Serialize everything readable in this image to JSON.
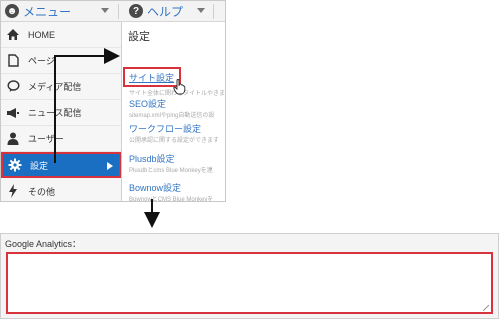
{
  "topbar": {
    "menu_label": "メニュー",
    "help_label": "ヘルプ"
  },
  "sidebar": {
    "items": [
      {
        "label": "HOME",
        "icon": "home-icon"
      },
      {
        "label": "ページ",
        "icon": "page-icon"
      },
      {
        "label": "メディア配信",
        "icon": "speech-bubble-icon"
      },
      {
        "label": "ニュース配信",
        "icon": "megaphone-icon"
      },
      {
        "label": "ユーザー",
        "icon": "user-icon"
      },
      {
        "label": "設定",
        "icon": "gear-icon",
        "active": true
      },
      {
        "label": "その他",
        "icon": "bolt-icon"
      }
    ]
  },
  "submenu": {
    "title": "設定",
    "items": [
      {
        "title": "サイト設定",
        "desc": "サイト全体に関わるタイトルやきます"
      },
      {
        "title": "SEO設定",
        "desc": "sitemap.xmlやping自動送信の設"
      },
      {
        "title": "ワークフロー設定",
        "desc": "公開承認に関する設定ができます"
      },
      {
        "title": "Plusdb設定",
        "desc": "Plusdbとcms Blue Monkeyを連"
      },
      {
        "title": "Bownow設定",
        "desc": "BownowとCMS Blue Monkeyを"
      }
    ]
  },
  "ga_panel": {
    "label": "Google Analytics：",
    "value": ""
  },
  "colors": {
    "accent": "#1a6fc2",
    "highlight": "#d8323c",
    "link": "#3274c3"
  }
}
